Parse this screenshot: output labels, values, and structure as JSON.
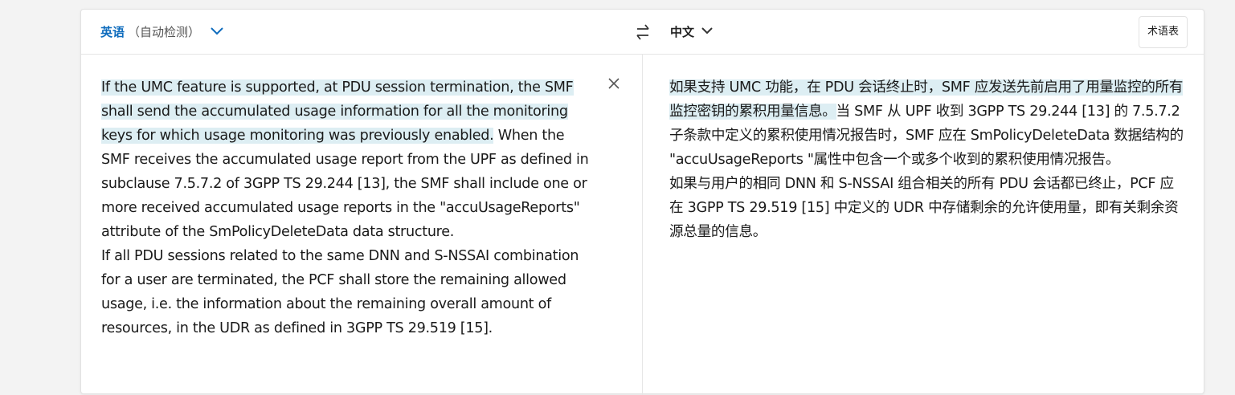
{
  "header": {
    "source_language": "英语",
    "detect_label": "（自动检测）",
    "target_language": "中文",
    "glossary_label": "术语表"
  },
  "source": {
    "highlighted": "If the UMC feature is supported, at PDU session termination, the SMF shall send the accumulated usage information for all the monitoring keys for which usage monitoring was previously enabled.",
    "rest": " When the SMF receives the accumulated usage report from the UPF as defined in subclause 7.5.7.2 of 3GPP TS 29.244 [13], the SMF shall include one or more received accumulated usage reports in the \"accuUsageReports\" attribute of the SmPolicyDeleteData data structure.",
    "para2": "If all PDU sessions related to the same DNN and S-NSSAI combination for a user are terminated, the PCF shall store the remaining allowed usage, i.e. the information about the remaining overall amount of resources, in the UDR as defined in 3GPP TS 29.519 [15]."
  },
  "target": {
    "highlighted": "如果支持 UMC 功能，在 PDU 会话终止时，SMF 应发送先前启用了用量监控的所有监控密钥的累积用量信息。",
    "rest": "当 SMF 从 UPF 收到 3GPP TS 29.244 [13] 的 7.5.7.2 子条款中定义的累积使用情况报告时，SMF 应在 SmPolicyDeleteData 数据结构的 \"accuUsageReports \"属性中包含一个或多个收到的累积使用情况报告。",
    "para2": "如果与用户的相同 DNN 和 S-NSSAI 组合相关的所有 PDU 会话都已终止，PCF 应在 3GPP TS 29.519 [15] 中定义的 UDR 中存储剩余的允许使用量，即有关剩余资源总量的信息。"
  },
  "icons": {
    "swap": "swap-icon",
    "close": "close-icon",
    "chevron": "chevron-down-icon"
  },
  "colors": {
    "accent": "#0f6cbd",
    "highlight": "#ddeef3"
  }
}
